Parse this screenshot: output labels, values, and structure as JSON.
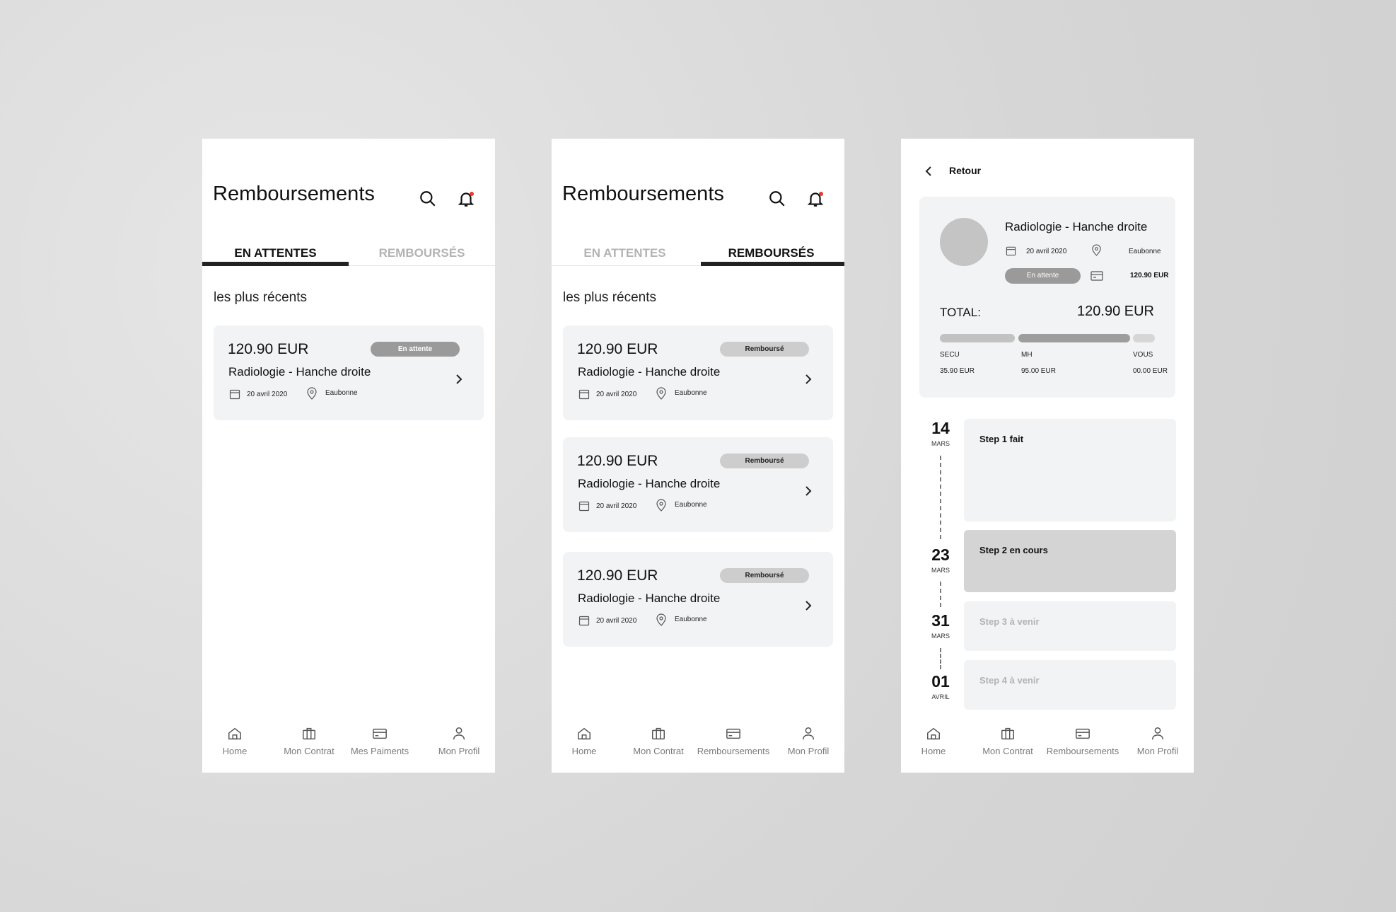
{
  "screens": {
    "pending": {
      "title": "Remboursements",
      "tabs": {
        "left": "EN ATTENTES",
        "right": "REMBOURSÉS"
      },
      "section": "les plus récents",
      "cards": [
        {
          "amount": "120.90 EUR",
          "status": "En attente",
          "label": "Radiologie - Hanche droite",
          "date": "20 avril 2020",
          "place": "Eaubonne"
        }
      ],
      "nav": [
        "Home",
        "Mon Contrat",
        "Mes Paiments",
        "Mon Profil"
      ]
    },
    "refunded": {
      "title": "Remboursements",
      "tabs": {
        "left": "EN ATTENTES",
        "right": "REMBOURSÉS"
      },
      "section": "les plus récents",
      "cards": [
        {
          "amount": "120.90 EUR",
          "status": "Remboursé",
          "label": "Radiologie - Hanche droite",
          "date": "20 avril 2020",
          "place": "Eaubonne"
        },
        {
          "amount": "120.90 EUR",
          "status": "Remboursé",
          "label": "Radiologie - Hanche droite",
          "date": "20 avril 2020",
          "place": "Eaubonne"
        },
        {
          "amount": "120.90 EUR",
          "status": "Remboursé",
          "label": "Radiologie - Hanche droite",
          "date": "20 avril 2020",
          "place": "Eaubonne"
        }
      ],
      "nav": [
        "Home",
        "Mon Contrat",
        "Remboursements",
        "Mon Profil"
      ]
    },
    "detail": {
      "back": "Retour",
      "title": "Radiologie - Hanche droite",
      "date": "20 avril 2020",
      "place": "Eaubonne",
      "status": "En attente",
      "payment": "120.90 EUR",
      "total_label": "TOTAL:",
      "total_value": "120.90 EUR",
      "breakdown": [
        {
          "name": "SECU",
          "value": "35.90 EUR"
        },
        {
          "name": "MH",
          "value": "95.00 EUR"
        },
        {
          "name": "VOUS",
          "value": "00.00 EUR"
        }
      ],
      "timeline": [
        {
          "day": "14",
          "month": "MARS",
          "step": "Step 1 fait"
        },
        {
          "day": "23",
          "month": "MARS",
          "step": "Step 2 en cours"
        },
        {
          "day": "31",
          "month": "MARS",
          "step": "Step 3 à venir"
        },
        {
          "day": "01",
          "month": "AVRIL",
          "step": "Step 4 à venir"
        }
      ],
      "nav": [
        "Home",
        "Mon Contrat",
        "Remboursements",
        "Mon Profil"
      ]
    }
  },
  "colors": {
    "notification_dot": "#e53935",
    "tab_indicator": "#222222",
    "card_bg": "#f2f3f4"
  },
  "icons": [
    "search-icon",
    "bell-icon",
    "calendar-icon",
    "location-pin-icon",
    "chevron-right-icon",
    "chevron-left-icon",
    "home-icon",
    "briefcase-icon",
    "credit-card-icon",
    "user-icon"
  ]
}
